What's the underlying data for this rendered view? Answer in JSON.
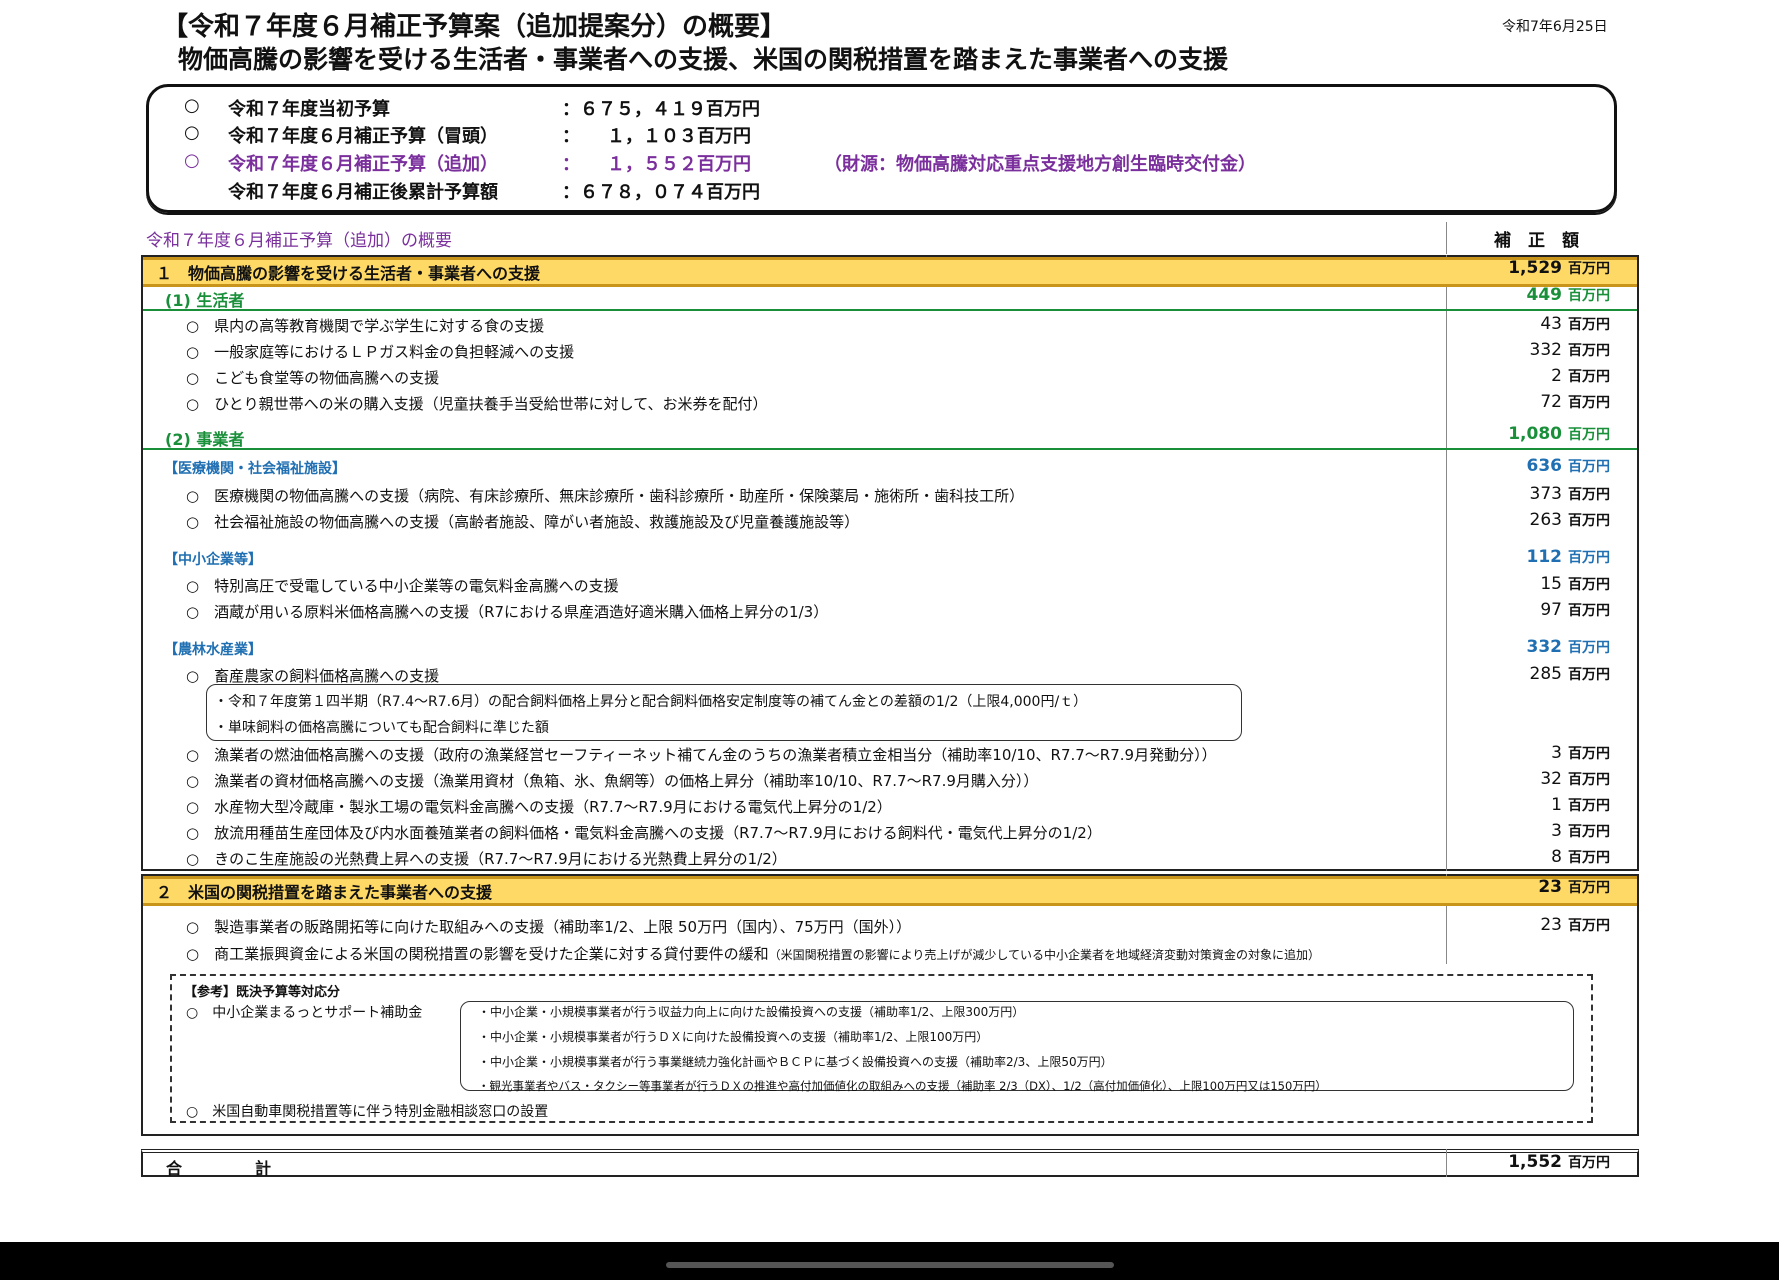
{
  "header": {
    "title_line1": "【令和７年度６月補正予算案（追加提案分）の概要】",
    "title_line2": "物価高騰の影響を受ける生活者・事業者への支援、米国の関税措置を踏まえた事業者への支援",
    "date": "令和7年6月25日"
  },
  "budget": {
    "lines": [
      {
        "bullet": "○",
        "label": "令和７年度当初予算",
        "value": "：６７５，４１９百万円",
        "note": ""
      },
      {
        "bullet": "○",
        "label": "令和７年度６月補正予算（冒頭）",
        "value": "：　　１，１０３百万円",
        "note": ""
      },
      {
        "bullet": "○",
        "label": "令和７年度６月補正予算（追加）",
        "value": "：　　１，５５２百万円",
        "note": "（財源：物価高騰対応重点支援地方創生臨時交付金）"
      },
      {
        "bullet": "",
        "label": "令和７年度６月補正後累計予算額",
        "value": "：６７８，０７４百万円",
        "note": ""
      }
    ]
  },
  "table": {
    "caption": "令和７年度６月補正予算（追加）の概要",
    "amount_header": "補　正　額",
    "unit": "百万円",
    "section1": {
      "title": "１　物価高騰の影響を受ける生活者・事業者への支援",
      "amount": "1,529",
      "sub1": {
        "title": "(1) 生活者",
        "amount": "449",
        "items": [
          {
            "text": "○　県内の高等教育機関で学ぶ学生に対する食の支援",
            "amount": "43"
          },
          {
            "text": "○　一般家庭等におけるＬＰガス料金の負担軽減への支援",
            "amount": "332"
          },
          {
            "text": "○　こども食堂等の物価高騰への支援",
            "amount": "2"
          },
          {
            "text": "○　ひとり親世帯への米の購入支援（児童扶養手当受給世帯に対して、お米券を配付）",
            "amount": "72"
          }
        ]
      },
      "sub2": {
        "title": "(2) 事業者",
        "amount": "1,080",
        "medical": {
          "title": "【医療機関・社会福祉施設】",
          "amount": "636",
          "items": [
            {
              "text": "○　医療機関の物価高騰への支援（病院、有床診療所、無床診療所・歯科診療所・助産所・保険薬局・施術所・歯科技工所）",
              "amount": "373"
            },
            {
              "text": "○　社会福祉施設の物価高騰への支援（高齢者施設、障がい者施設、救護施設及び児童養護施設等）",
              "amount": "263"
            }
          ]
        },
        "sme": {
          "title": "【中小企業等】",
          "amount": "112",
          "items": [
            {
              "text": "○　特別高圧で受電している中小企業等の電気料金高騰への支援",
              "amount": "15"
            },
            {
              "text": "○　酒蔵が用いる原料米価格高騰への支援（R7における県産酒造好適米購入価格上昇分の1/3）",
              "amount": "97"
            }
          ]
        },
        "agri": {
          "title": "【農林水産業】",
          "amount": "332",
          "item1": {
            "text": "○　畜産農家の飼料価格高騰への支援",
            "amount": "285"
          },
          "notes": [
            "・令和７年度第１四半期（R7.4～R7.6月）の配合飼料価格上昇分と配合飼料価格安定制度等の補てん金との差額の1/2（上限4,000円/ｔ）",
            "・単味飼料の価格高騰についても配合飼料に準じた額"
          ],
          "items": [
            {
              "text": "○　漁業者の燃油価格高騰への支援（政府の漁業経営セーフティーネット補てん金のうちの漁業者積立金相当分（補助率10/10、R7.7～R7.9月発動分））",
              "amount": "3"
            },
            {
              "text": "○　漁業者の資材価格高騰への支援（漁業用資材（魚箱、氷、魚網等）の価格上昇分（補助率10/10、R7.7～R7.9月購入分））",
              "amount": "32"
            },
            {
              "text": "○　水産物大型冷蔵庫・製氷工場の電気料金高騰への支援（R7.7～R7.9月における電気代上昇分の1/2）",
              "amount": "1"
            },
            {
              "text": "○　放流用種苗生産団体及び内水面養殖業者の飼料価格・電気料金高騰への支援（R7.7～R7.9月における飼料代・電気代上昇分の1/2）",
              "amount": "3"
            },
            {
              "text": "○　きのこ生産施設の光熱費上昇への支援（R7.7～R7.9月における光熱費上昇分の1/2）",
              "amount": "8"
            }
          ]
        }
      }
    },
    "section2": {
      "title": "２　米国の関税措置を踏まえた事業者への支援",
      "amount": "23",
      "item1": {
        "text": "○　製造事業者の販路開拓等に向けた取組みへの支援（補助率1/2、上限 50万円（国内）、75万円（国外））",
        "amount": "23"
      },
      "item2": {
        "text": "○　商工業振興資金による米国の関税措置の影響を受けた企業に対する貸付要件の緩和",
        "note": "（米国関税措置の影響により売上げが減少している中小企業者を地域経済変動対策資金の対象に追加）"
      }
    },
    "reference": {
      "title": "【参考】既決予算等対応分",
      "item1": "○　中小企業まるっとサポート補助金",
      "details": [
        "・中小企業・小規模事業者が行う収益力向上に向けた設備投資への支援（補助率1/2、上限300万円）",
        "・中小企業・小規模事業者が行うＤＸに向けた設備投資への支援（補助率1/2、上限100万円）",
        "・中小企業・小規模事業者が行う事業継続力強化計画やＢＣＰに基づく設備投資への支援（補助率2/3、上限50万円）",
        "・観光事業者やバス・タクシー等事業者が行うＤＸの推進や高付加価値化の取組みへの支援（補助率 2/3（DX）、1/2（高付加価値化）、上限100万円又は150万円）"
      ],
      "item2": "○　米国自動車関税措置等に伴う特別金融相談窓口の設置"
    },
    "total": {
      "label_a": "合",
      "label_b": "計",
      "amount": "1,552"
    }
  }
}
